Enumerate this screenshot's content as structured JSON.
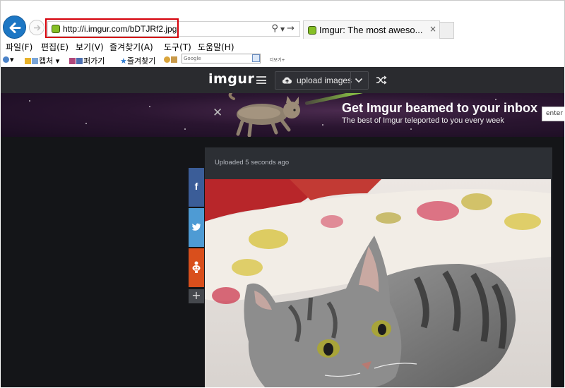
{
  "browser": {
    "address": {
      "url": "http://i.imgur.com/bDTJRf2.jpg"
    },
    "tab": {
      "title": "Imgur: The most aweso...",
      "close": "×"
    },
    "menu": {
      "file": "파일(F)",
      "edit": "편집(E)",
      "view": "보기(V)",
      "favorites": "즐겨찾기(A)",
      "tools": "도구(T)",
      "help": "도움말(H)"
    },
    "favbar": {
      "capture": "캡처",
      "pagaki": "퍼가기",
      "favorites": "즐겨찾기",
      "google": "Google",
      "more": "더보기+"
    }
  },
  "site": {
    "logo": "imgur",
    "upload_label": "upload images",
    "banner": {
      "title": "Get Imgur beamed to your inbox",
      "subtitle": "The best of Imgur teleported to you every week",
      "input_placeholder": "enter s"
    },
    "post": {
      "meta": "Uploaded 5 seconds ago"
    },
    "share": {
      "facebook": "f",
      "reddit": "",
      "more": "+"
    }
  },
  "colors": {
    "accent_red": "#d6000a",
    "imgur_dark": "#141518",
    "nav_bar": "#2a2b2f",
    "favicon_green": "#85bf25",
    "facebook": "#3b5d98",
    "twitter": "#4e9bd4",
    "reddit": "#d94f1c"
  }
}
